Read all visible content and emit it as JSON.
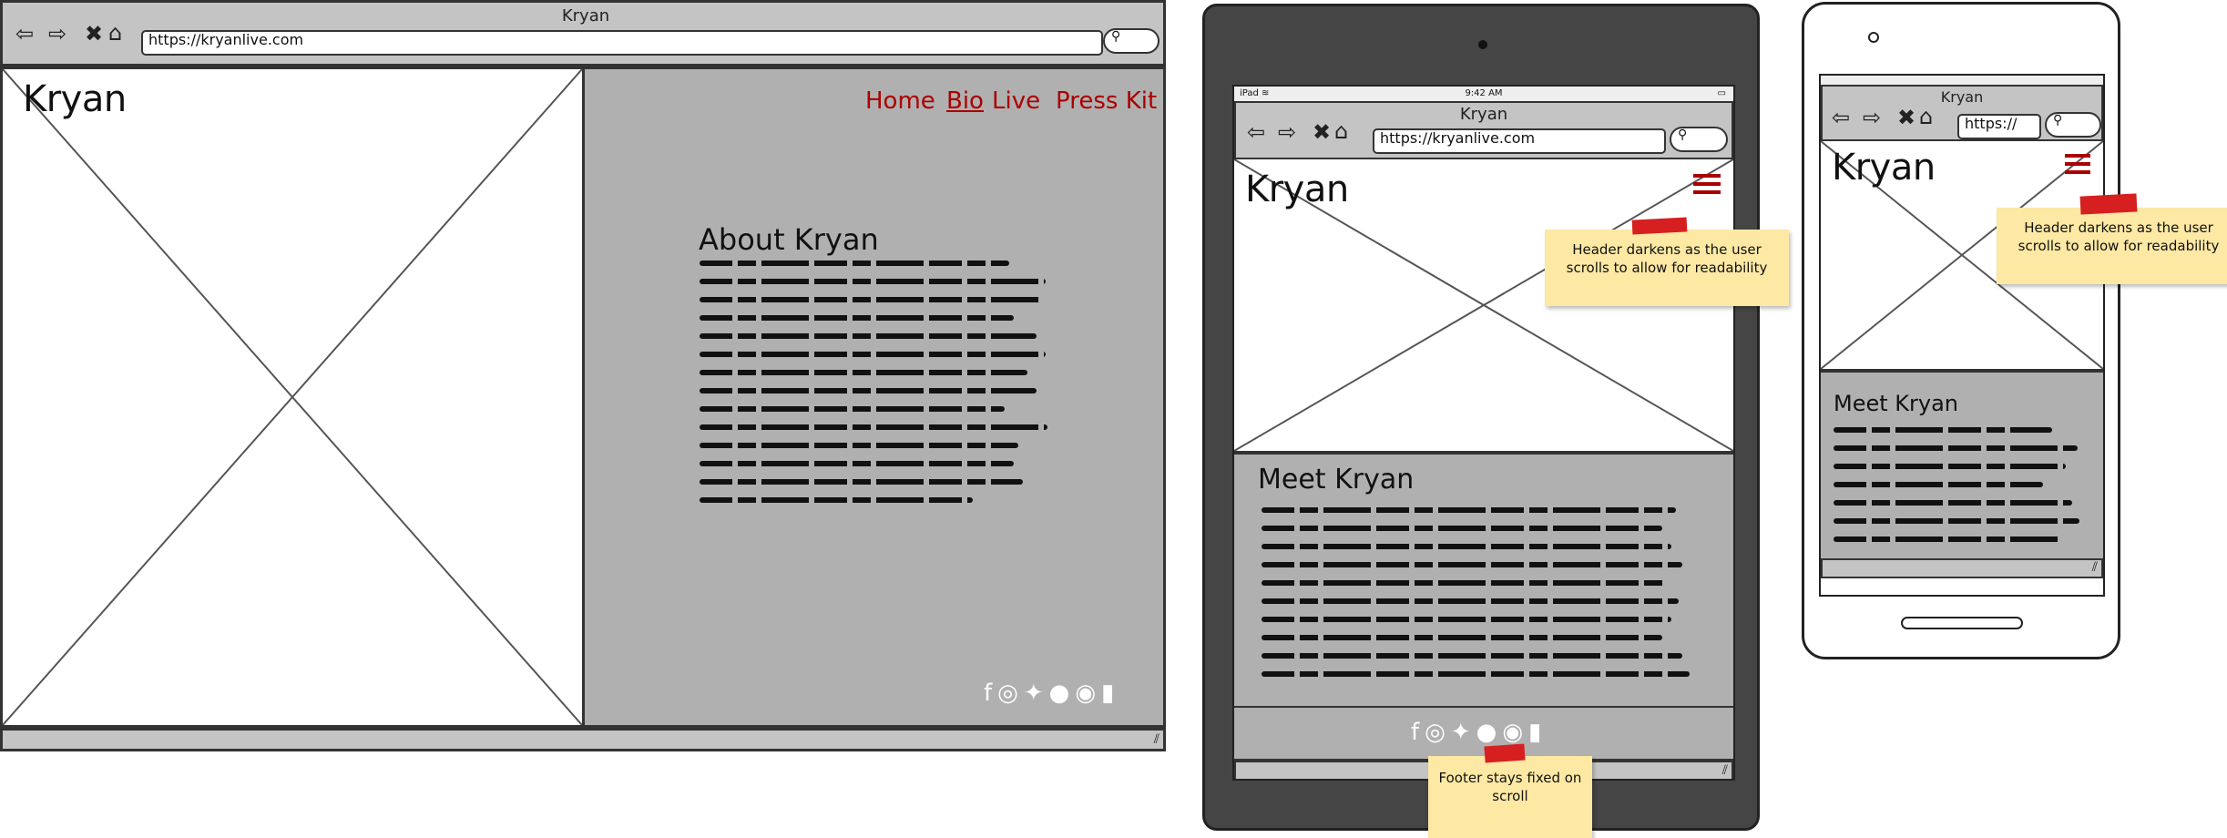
{
  "site": {
    "brand": "Kryan",
    "window_title": "Kryan",
    "url": "https://kryanlive.com",
    "url_short": "https://"
  },
  "nav": {
    "items": [
      "Home",
      "Bio",
      "Live",
      "Press Kit"
    ],
    "active": "Bio"
  },
  "desktop": {
    "section_heading": "About Kryan"
  },
  "tablet": {
    "status_device": "iPad",
    "status_time": "9:42 AM",
    "section_heading": "Meet Kryan"
  },
  "phone": {
    "section_heading": "Meet Kryan"
  },
  "notes": {
    "header_tablet": "Header darkens as the user scrolls to allow for readability",
    "header_phone": "Header darkens as the user scrolls to allow for readability",
    "footer": "Footer stays fixed on scroll"
  },
  "social_icons": [
    "facebook-icon",
    "instagram-icon",
    "twitter-icon",
    "apple-icon",
    "spotify-icon",
    "audio-bars-icon"
  ],
  "colors": {
    "link": "#aa0000",
    "panel": "#b0b0b0",
    "chrome": "#c4c4c4",
    "sticky": "#fde8a4",
    "tape": "#d62020",
    "device": "#454545"
  }
}
